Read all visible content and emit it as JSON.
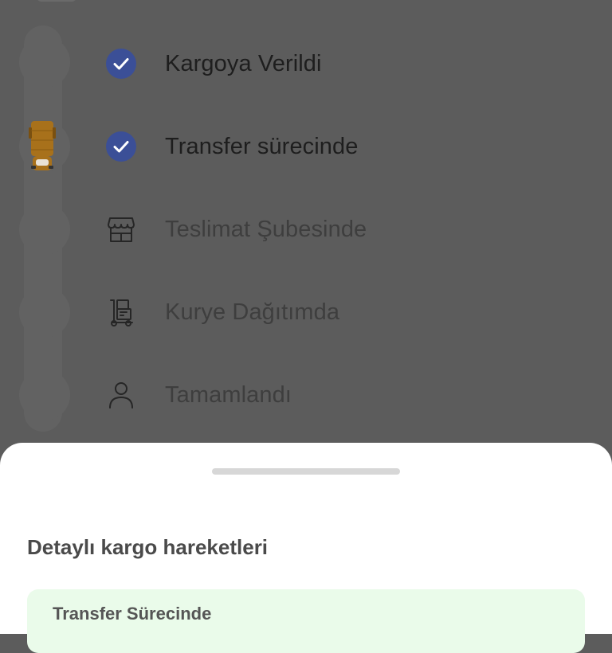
{
  "tracking": {
    "steps": [
      {
        "label": "Kargoya Verildi",
        "status": "done",
        "icon": "check-circle-icon"
      },
      {
        "label": "Transfer sürecinde",
        "status": "done",
        "icon": "check-circle-icon"
      },
      {
        "label": "Teslimat Şubesinde",
        "status": "pending",
        "icon": "store-icon"
      },
      {
        "label": "Kurye Dağıtımda",
        "status": "pending",
        "icon": "courier-dolly-icon"
      },
      {
        "label": "Tamamlandı",
        "status": "pending",
        "icon": "person-icon"
      }
    ],
    "current_marker_icon": "truck-icon"
  },
  "bottom_sheet": {
    "title": "Detaylı kargo hareketleri",
    "events": [
      {
        "title": "Transfer Sürecinde"
      }
    ]
  },
  "colors": {
    "check_fill": "#3b4f97",
    "truck": "#a8711b",
    "event_card_bg": "#eafbea",
    "overlay": "#5c5c5c"
  }
}
